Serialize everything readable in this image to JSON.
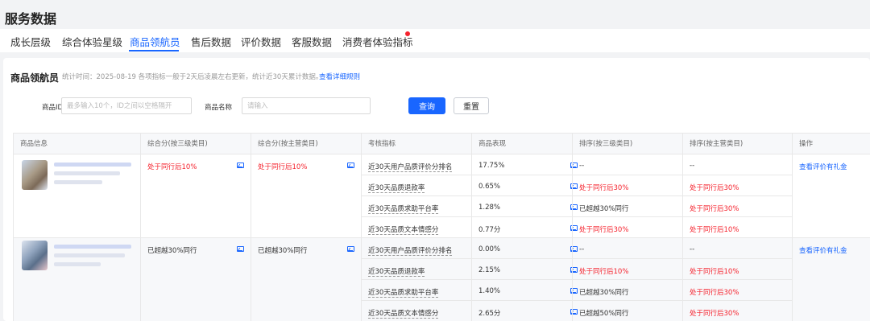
{
  "page_title": "服务数据",
  "tabs": [
    {
      "label": "成长层级"
    },
    {
      "label": "综合体验星级"
    },
    {
      "label": "商品领航员",
      "active": true
    },
    {
      "label": "售后数据"
    },
    {
      "label": "评价数据"
    },
    {
      "label": "客服数据"
    },
    {
      "label": "消费者体验指标",
      "has_red_dot": true
    }
  ],
  "section": {
    "title": "商品领航员",
    "note": "统计时间：2025-08-19 各项指标一般于2天后凌晨左右更新，统计近30天累计数据。",
    "rules_link": "查看详细规则"
  },
  "filters": {
    "product_id_label": "商品ID",
    "product_id_placeholder": "最多输入10个，ID之间以空格隔开",
    "product_name_label": "商品名称",
    "product_name_placeholder": "请输入",
    "query_button": "查询",
    "reset_button": "重置"
  },
  "table": {
    "headers": [
      "商品信息",
      "综合分(按三级类目)",
      "综合分(按主营类目)",
      "考核指标",
      "商品表现",
      "排序(按三级类目)",
      "排序(按主营类目)",
      "操作"
    ],
    "groups": [
      {
        "score_cat3": "处于同行后10%",
        "score_main": "处于同行后10%",
        "action": "查看评价有礼金",
        "rows": [
          {
            "metric": "近30天用户品质评价分排名",
            "value": "17.75%",
            "rank_cat3": "--",
            "rank_main": "--"
          },
          {
            "metric": "近30天品质退款率",
            "value": "0.65%",
            "rank_cat3": "处于同行后30%",
            "rank_main": "处于同行后30%"
          },
          {
            "metric": "近30天品质求助平台率",
            "value": "1.28%",
            "rank_cat3": "已超越30%同行",
            "rank_main": "处于同行后30%"
          },
          {
            "metric": "近30天品质文本情感分",
            "value": "0.77分",
            "rank_cat3": "处于同行后30%",
            "rank_main": "处于同行后10%"
          }
        ]
      },
      {
        "score_cat3": "已超越30%同行",
        "score_main": "已超越30%同行",
        "action": "查看评价有礼金",
        "rows": [
          {
            "metric": "近30天用户品质评价分排名",
            "value": "0.00%",
            "rank_cat3": "--",
            "rank_main": "--"
          },
          {
            "metric": "近30天品质退款率",
            "value": "2.15%",
            "rank_cat3": "处于同行后10%",
            "rank_main": "处于同行后10%"
          },
          {
            "metric": "近30天品质求助平台率",
            "value": "1.40%",
            "rank_cat3": "已超越30%同行",
            "rank_main": "处于同行后30%"
          },
          {
            "metric": "近30天品质文本情感分",
            "value": "2.65分",
            "rank_cat3": "已超越50%同行",
            "rank_main": "处于同行后30%"
          }
        ]
      }
    ]
  },
  "colors": {
    "accent": "#1966ff",
    "negative": "#f5222d",
    "header_bg": "#f7f8fa"
  },
  "icons": {
    "trend": "chart-trend-icon",
    "notification_dot": "red-dot"
  }
}
